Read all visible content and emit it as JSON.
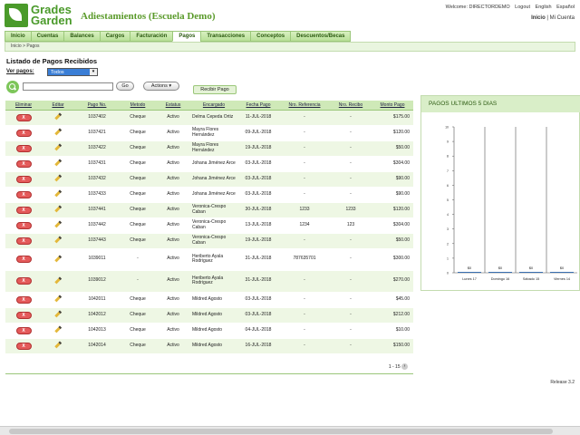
{
  "header": {
    "logo_line1": "Grades",
    "logo_line2": "Garden",
    "app_title": "Adiestamientos (Escuela Demo)",
    "welcome": "Welcome: DIRECTORDEMO",
    "logout": "Logout",
    "english": "English",
    "espanol": "Español",
    "inicio": "Inicio",
    "sep": "|",
    "mi_cuenta": "Mi Cuenta"
  },
  "nav": {
    "items": [
      "Inicio",
      "Cuentas",
      "Balances",
      "Cargos",
      "Facturación",
      "Pagos",
      "Transacciones",
      "Conceptos",
      "Descuentos/Becas"
    ],
    "active": "Pagos"
  },
  "breadcrumb": "Inicio  >  Pagos",
  "listing": {
    "title": "Listado de Pagos Recibidos",
    "ver_label": "Ver pagos:",
    "ver_value": "Todos",
    "go_label": "Go",
    "actions_label": "Actions ▾",
    "recibir_label": "Recibir Pago",
    "pager": "1 - 15",
    "pager_next": "›"
  },
  "table": {
    "headers": [
      "Eliminar",
      "Editar",
      "Pago No.",
      "Metodo",
      "Estatus",
      "Encargado",
      "Fecha Pago",
      "Nro. Referencia",
      "Nro. Recibo",
      "Monto Pago"
    ],
    "delete_label": "X",
    "rows": [
      [
        "1037402",
        "Cheque",
        "Activo",
        "Delma Cepeda Ortiz",
        "11-JUL-2018",
        "-",
        "-",
        "$175.00"
      ],
      [
        "1037421",
        "Cheque",
        "Activo",
        "Mayra Flores Hernández",
        "09-JUL-2018",
        "-",
        "-",
        "$120.00"
      ],
      [
        "1037422",
        "Cheque",
        "Activo",
        "Mayra Flores Hernández",
        "19-JUL-2018",
        "-",
        "-",
        "$50.00"
      ],
      [
        "1037431",
        "Cheque",
        "Activo",
        "Johana Jiménez Arce",
        "03-JUL-2018",
        "-",
        "-",
        "$304.00"
      ],
      [
        "1037432",
        "Cheque",
        "Activo",
        "Johana Jiménez Arce",
        "03-JUL-2018",
        "-",
        "-",
        "$90.00"
      ],
      [
        "1037433",
        "Cheque",
        "Activo",
        "Johana Jiménez Arce",
        "03-JUL-2018",
        "-",
        "-",
        "$90.00"
      ],
      [
        "1037441",
        "Cheque",
        "Activo",
        "Veronica-Crespo Caban",
        "30-JUL-2018",
        "1233",
        "1233",
        "$120.00"
      ],
      [
        "1037442",
        "Cheque",
        "Activo",
        "Veronica-Crespo Caban",
        "13-JUL-2018",
        "1234",
        "123",
        "$304.00"
      ],
      [
        "1037443",
        "Cheque",
        "Activo",
        "Veronica-Crespo Caban",
        "19-JUL-2018",
        "-",
        "-",
        "$50.00"
      ],
      [
        "1039011",
        "-",
        "Activo",
        "Heriberto Ayala Rodriguez",
        "31-JUL-2018",
        "787635701",
        "-",
        "$300.00"
      ],
      [
        "1039012",
        "-",
        "Activo",
        "Heriberto Ayala Rodriguez",
        "31-JUL-2018",
        "-",
        "-",
        "$270.00"
      ],
      [
        "1042011",
        "Cheque",
        "Activo",
        "Mildred Agosto",
        "03-JUL-2018",
        "-",
        "-",
        "$45.00"
      ],
      [
        "1042012",
        "Cheque",
        "Activo",
        "Mildred Agosto",
        "03-JUL-2018",
        "-",
        "-",
        "$212.00"
      ],
      [
        "1042013",
        "Cheque",
        "Activo",
        "Mildred Agosto",
        "04-JUL-2018",
        "-",
        "-",
        "$10.00"
      ],
      [
        "1042014",
        "Cheque",
        "Activo",
        "Mildred Agosto",
        "16-JUL-2018",
        "-",
        "-",
        "$150.00"
      ]
    ]
  },
  "chart_panel": {
    "title": "PAGOS ULTIMOS 5 DIAS"
  },
  "chart_data": {
    "type": "bar",
    "title": "PAGOS ULTIMOS 5 DIAS",
    "categories": [
      "Lunes 17",
      "Domingo 16",
      "Sábado 15",
      "Viernes 14"
    ],
    "values": [
      0,
      0,
      0,
      0
    ],
    "value_labels": [
      "$0",
      "$0",
      "$0",
      "$0"
    ],
    "y_ticks": [
      "0",
      "1",
      "2",
      "3",
      "4",
      "5",
      "6",
      "7",
      "8",
      "9",
      "10"
    ],
    "ylim": [
      0,
      10
    ],
    "grid": false,
    "bar_color": "#3a6fb0"
  },
  "footer": {
    "release": "Release 3.2"
  },
  "colors": {
    "brand_green": "#4a9a2a",
    "nav_bg": "#b8e098",
    "delete_red": "#e45a5a"
  }
}
